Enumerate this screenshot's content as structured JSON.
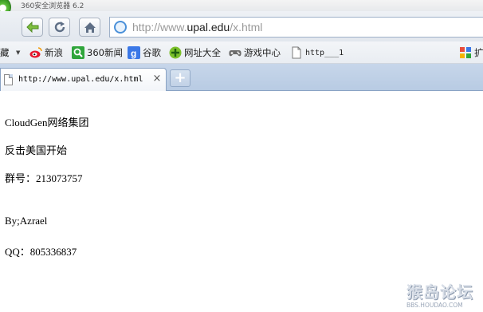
{
  "window": {
    "title": "360安全浏览器 6.2"
  },
  "nav": {
    "back_icon": "back-arrow-icon",
    "refresh_icon": "refresh-icon",
    "home_icon": "home-icon",
    "url_prefix": "http://www.",
    "url_host": "upal.edu",
    "url_suffix": "/x.html"
  },
  "bookmarks": {
    "folder_label": "藏",
    "items": [
      {
        "label": "新浪",
        "icon": "weibo-icon"
      },
      {
        "label": "360新闻",
        "icon": "search-icon"
      },
      {
        "label": "谷歌",
        "icon": "google-icon"
      },
      {
        "label": "网址大全",
        "icon": "plus-circle-icon"
      },
      {
        "label": "游戏中心",
        "icon": "gamepad-icon"
      },
      {
        "label": "http___1",
        "icon": "page-icon"
      }
    ],
    "extensions_label": "扩"
  },
  "tabs": {
    "active_title": "http://www.upal.edu/x.html",
    "close_glyph": "×",
    "new_tab_glyph": "+"
  },
  "page": {
    "lines": [
      "CloudGen网络集团",
      "反击美国开始",
      "群号：213073757",
      "By;Azrael",
      "QQ：805336837"
    ]
  },
  "watermark": {
    "text": "猴岛论坛",
    "url": "BBS.HOUDAO.COM"
  },
  "colors": {
    "accent_blue": "#4a90d9",
    "tab_strip": "#c7d6ea",
    "logo_green": "#5fc03c"
  }
}
